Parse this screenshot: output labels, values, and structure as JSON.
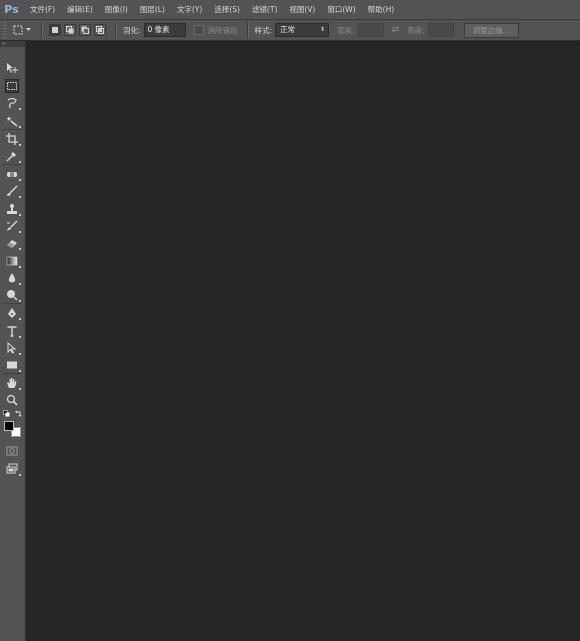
{
  "app": {
    "logo": "Ps"
  },
  "menu": [
    "文件(F)",
    "编辑(E)",
    "图像(I)",
    "图层(L)",
    "文字(Y)",
    "选择(S)",
    "滤镜(T)",
    "视图(V)",
    "窗口(W)",
    "帮助(H)"
  ],
  "options": {
    "feather_label": "羽化:",
    "feather_value": "0 像素",
    "antialias_label": "消除锯齿",
    "style_label": "样式:",
    "style_value": "正常",
    "width_label": "宽度:",
    "height_label": "高度:",
    "refine_edge_label": "调整边缘..."
  },
  "tools": [
    "move-icon",
    "rectangular-marquee-icon",
    "lasso-icon",
    "magic-wand-icon",
    "crop-icon",
    "eyedropper-icon",
    "healing-brush-icon",
    "brush-icon",
    "clone-stamp-icon",
    "history-brush-icon",
    "eraser-icon",
    "gradient-icon",
    "blur-icon",
    "dodge-icon",
    "pen-icon",
    "type-icon",
    "path-selection-icon",
    "rectangle-shape-icon",
    "hand-icon",
    "zoom-icon"
  ],
  "colors": {
    "foreground": "#000000",
    "background": "#ffffff",
    "canvas": "#252526"
  }
}
